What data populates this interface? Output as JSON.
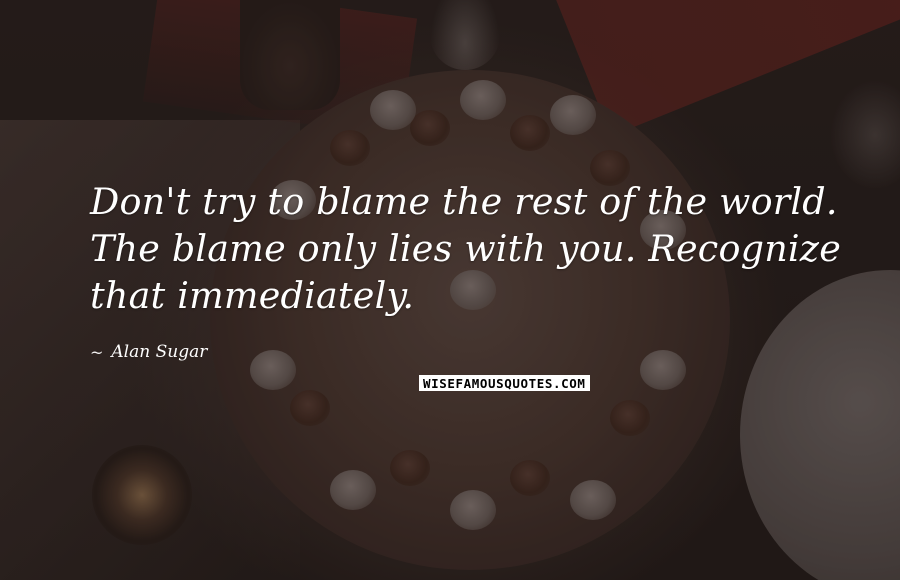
{
  "quote": {
    "lines": [
      "Don't try to blame the rest of the world.",
      "The blame only lies with you. Recognize",
      "that immediately."
    ]
  },
  "author": {
    "prefix_icon": "tilde-dash-icon",
    "name": "Alan Sugar"
  },
  "watermark": {
    "text": "WISEFAMOUSQUOTES.COM"
  }
}
